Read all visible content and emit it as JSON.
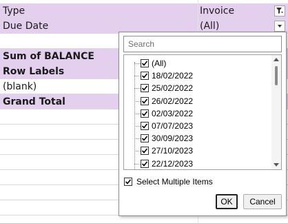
{
  "sheet": {
    "rows": [
      {
        "label": "Type",
        "value": "Invoice",
        "bold": false,
        "style": "pivot"
      },
      {
        "label": "Due Date",
        "value": "(All)",
        "bold": false,
        "style": "pivot"
      },
      {
        "label": "",
        "value": "",
        "bold": false,
        "style": "plain"
      },
      {
        "label": "Sum of BALANCE",
        "value": "",
        "bold": true,
        "style": "pivot"
      },
      {
        "label": "Row Labels",
        "value": "",
        "bold": true,
        "style": "pivot"
      },
      {
        "label": "(blank)",
        "value": "",
        "bold": false,
        "style": "plain"
      },
      {
        "label": "Grand Total",
        "value": "",
        "bold": true,
        "style": "pivot"
      }
    ]
  },
  "filter_popup": {
    "search_placeholder": "Search",
    "items": [
      {
        "label": "(All)",
        "checked": true
      },
      {
        "label": "18/02/2022",
        "checked": true
      },
      {
        "label": "25/02/2022",
        "checked": true
      },
      {
        "label": "26/02/2022",
        "checked": true
      },
      {
        "label": "02/03/2022",
        "checked": true
      },
      {
        "label": "07/07/2023",
        "checked": true
      },
      {
        "label": "30/09/2023",
        "checked": true
      },
      {
        "label": "27/10/2023",
        "checked": true
      },
      {
        "label": "22/12/2023",
        "checked": true
      }
    ],
    "select_multiple_label": "Select Multiple Items",
    "select_multiple_checked": true,
    "ok_label": "OK",
    "cancel_label": "Cancel"
  },
  "colors": {
    "pivot_fill": "#e4d0ee",
    "gridline": "#d9d9d9"
  },
  "icons": {
    "type_filter": "filter-dropdown-icon",
    "due_date_dropdown": "chevron-down-icon"
  }
}
